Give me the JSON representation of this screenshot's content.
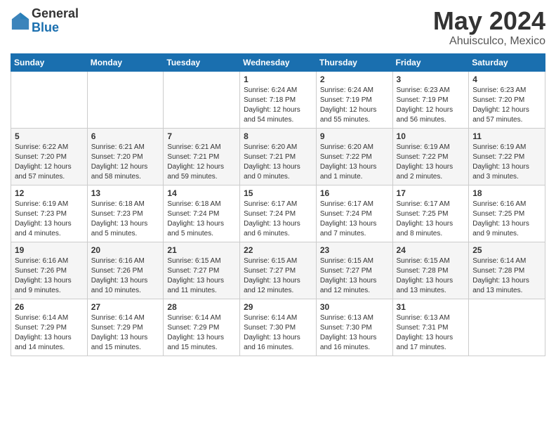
{
  "header": {
    "logo_general": "General",
    "logo_blue": "Blue",
    "title": "May 2024",
    "location": "Ahuisculco, Mexico"
  },
  "days_of_week": [
    "Sunday",
    "Monday",
    "Tuesday",
    "Wednesday",
    "Thursday",
    "Friday",
    "Saturday"
  ],
  "weeks": [
    [
      {
        "day": "",
        "info": ""
      },
      {
        "day": "",
        "info": ""
      },
      {
        "day": "",
        "info": ""
      },
      {
        "day": "1",
        "info": "Sunrise: 6:24 AM\nSunset: 7:18 PM\nDaylight: 12 hours\nand 54 minutes."
      },
      {
        "day": "2",
        "info": "Sunrise: 6:24 AM\nSunset: 7:19 PM\nDaylight: 12 hours\nand 55 minutes."
      },
      {
        "day": "3",
        "info": "Sunrise: 6:23 AM\nSunset: 7:19 PM\nDaylight: 12 hours\nand 56 minutes."
      },
      {
        "day": "4",
        "info": "Sunrise: 6:23 AM\nSunset: 7:20 PM\nDaylight: 12 hours\nand 57 minutes."
      }
    ],
    [
      {
        "day": "5",
        "info": "Sunrise: 6:22 AM\nSunset: 7:20 PM\nDaylight: 12 hours\nand 57 minutes."
      },
      {
        "day": "6",
        "info": "Sunrise: 6:21 AM\nSunset: 7:20 PM\nDaylight: 12 hours\nand 58 minutes."
      },
      {
        "day": "7",
        "info": "Sunrise: 6:21 AM\nSunset: 7:21 PM\nDaylight: 12 hours\nand 59 minutes."
      },
      {
        "day": "8",
        "info": "Sunrise: 6:20 AM\nSunset: 7:21 PM\nDaylight: 13 hours\nand 0 minutes."
      },
      {
        "day": "9",
        "info": "Sunrise: 6:20 AM\nSunset: 7:22 PM\nDaylight: 13 hours\nand 1 minute."
      },
      {
        "day": "10",
        "info": "Sunrise: 6:19 AM\nSunset: 7:22 PM\nDaylight: 13 hours\nand 2 minutes."
      },
      {
        "day": "11",
        "info": "Sunrise: 6:19 AM\nSunset: 7:22 PM\nDaylight: 13 hours\nand 3 minutes."
      }
    ],
    [
      {
        "day": "12",
        "info": "Sunrise: 6:19 AM\nSunset: 7:23 PM\nDaylight: 13 hours\nand 4 minutes."
      },
      {
        "day": "13",
        "info": "Sunrise: 6:18 AM\nSunset: 7:23 PM\nDaylight: 13 hours\nand 5 minutes."
      },
      {
        "day": "14",
        "info": "Sunrise: 6:18 AM\nSunset: 7:24 PM\nDaylight: 13 hours\nand 5 minutes."
      },
      {
        "day": "15",
        "info": "Sunrise: 6:17 AM\nSunset: 7:24 PM\nDaylight: 13 hours\nand 6 minutes."
      },
      {
        "day": "16",
        "info": "Sunrise: 6:17 AM\nSunset: 7:24 PM\nDaylight: 13 hours\nand 7 minutes."
      },
      {
        "day": "17",
        "info": "Sunrise: 6:17 AM\nSunset: 7:25 PM\nDaylight: 13 hours\nand 8 minutes."
      },
      {
        "day": "18",
        "info": "Sunrise: 6:16 AM\nSunset: 7:25 PM\nDaylight: 13 hours\nand 9 minutes."
      }
    ],
    [
      {
        "day": "19",
        "info": "Sunrise: 6:16 AM\nSunset: 7:26 PM\nDaylight: 13 hours\nand 9 minutes."
      },
      {
        "day": "20",
        "info": "Sunrise: 6:16 AM\nSunset: 7:26 PM\nDaylight: 13 hours\nand 10 minutes."
      },
      {
        "day": "21",
        "info": "Sunrise: 6:15 AM\nSunset: 7:27 PM\nDaylight: 13 hours\nand 11 minutes."
      },
      {
        "day": "22",
        "info": "Sunrise: 6:15 AM\nSunset: 7:27 PM\nDaylight: 13 hours\nand 12 minutes."
      },
      {
        "day": "23",
        "info": "Sunrise: 6:15 AM\nSunset: 7:27 PM\nDaylight: 13 hours\nand 12 minutes."
      },
      {
        "day": "24",
        "info": "Sunrise: 6:15 AM\nSunset: 7:28 PM\nDaylight: 13 hours\nand 13 minutes."
      },
      {
        "day": "25",
        "info": "Sunrise: 6:14 AM\nSunset: 7:28 PM\nDaylight: 13 hours\nand 13 minutes."
      }
    ],
    [
      {
        "day": "26",
        "info": "Sunrise: 6:14 AM\nSunset: 7:29 PM\nDaylight: 13 hours\nand 14 minutes."
      },
      {
        "day": "27",
        "info": "Sunrise: 6:14 AM\nSunset: 7:29 PM\nDaylight: 13 hours\nand 15 minutes."
      },
      {
        "day": "28",
        "info": "Sunrise: 6:14 AM\nSunset: 7:29 PM\nDaylight: 13 hours\nand 15 minutes."
      },
      {
        "day": "29",
        "info": "Sunrise: 6:14 AM\nSunset: 7:30 PM\nDaylight: 13 hours\nand 16 minutes."
      },
      {
        "day": "30",
        "info": "Sunrise: 6:13 AM\nSunset: 7:30 PM\nDaylight: 13 hours\nand 16 minutes."
      },
      {
        "day": "31",
        "info": "Sunrise: 6:13 AM\nSunset: 7:31 PM\nDaylight: 13 hours\nand 17 minutes."
      },
      {
        "day": "",
        "info": ""
      }
    ]
  ]
}
